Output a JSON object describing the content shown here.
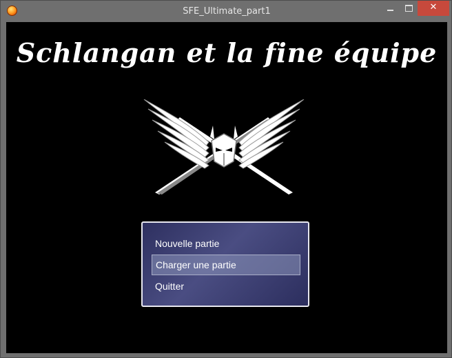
{
  "window": {
    "title": "SFE_Ultimate_part1",
    "minimize_glyph": "",
    "close_glyph": "✕"
  },
  "game": {
    "title": "Schlangan et la fine équipe",
    "emblem_icon": "winged-helmet-crossed-swords-icon"
  },
  "menu": {
    "selected_index": 1,
    "items": [
      {
        "label": "Nouvelle partie"
      },
      {
        "label": "Charger une partie"
      },
      {
        "label": "Quitter"
      }
    ]
  },
  "colors": {
    "menu_bg": "#3a3c70",
    "close_button": "#c7493c"
  }
}
